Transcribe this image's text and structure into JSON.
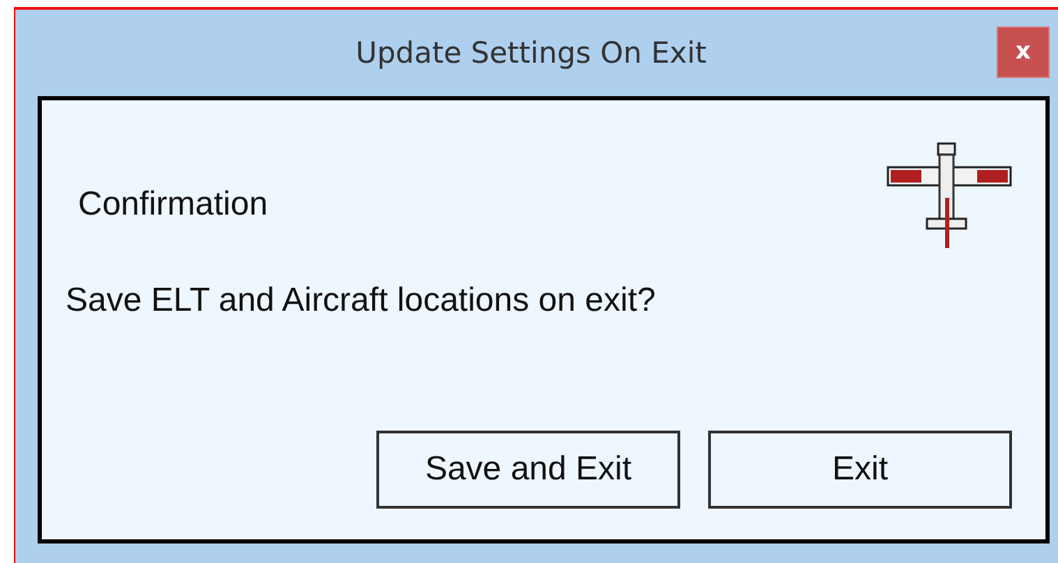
{
  "window": {
    "title": "Update Settings On Exit",
    "close": "x"
  },
  "heading": "Confirmation",
  "message": "Save ELT and Aircraft locations on exit?",
  "buttons": [
    "Save and Exit",
    "Exit"
  ]
}
